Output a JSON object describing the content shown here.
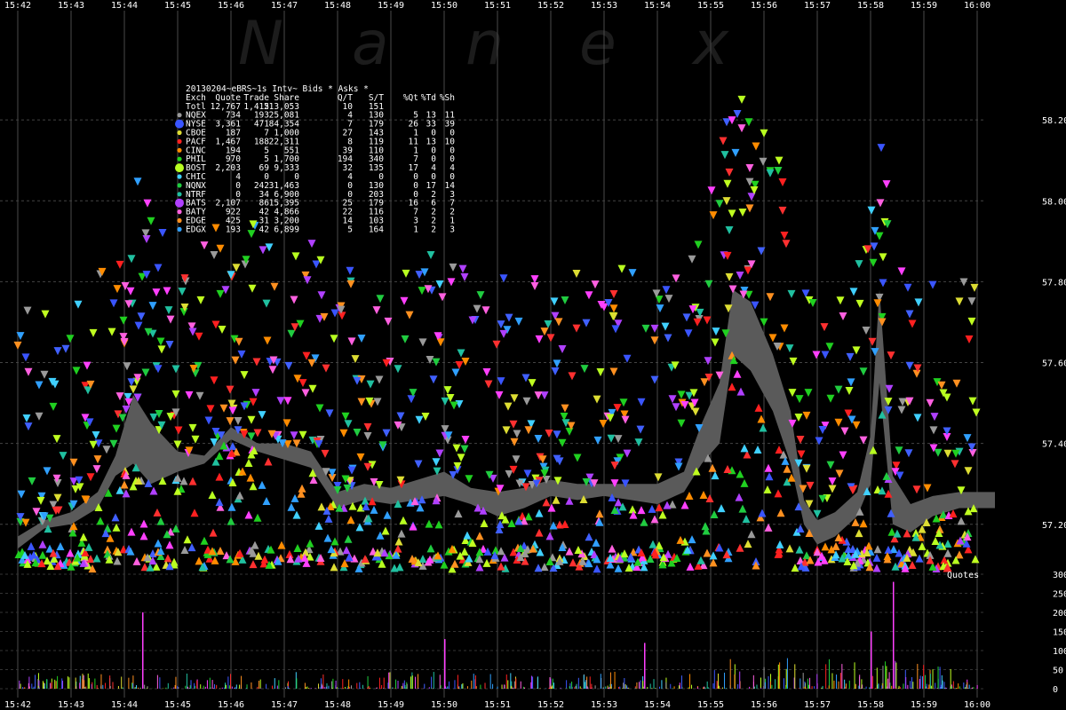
{
  "watermark_letters": [
    "N",
    "a",
    "n",
    "e",
    "x"
  ],
  "chart_data": [
    {
      "type": "scatter",
      "title": "",
      "x_ticks": [
        "15:42",
        "15:43",
        "15:44",
        "15:45",
        "15:46",
        "15:47",
        "15:48",
        "15:49",
        "15:50",
        "15:51",
        "15:52",
        "15:53",
        "15:54",
        "15:55",
        "15:56",
        "15:57",
        "15:58",
        "15:59",
        "16:00"
      ],
      "y_ticks": [
        "58.20",
        "58.00",
        "57.80",
        "57.60",
        "57.40",
        "57.20"
      ],
      "ylim": [
        57.07,
        58.3
      ],
      "grid": true,
      "description_series": [
        {
          "name": "Bids",
          "marker": "triangle-up"
        },
        {
          "name": "Asks",
          "marker": "triangle-down"
        }
      ],
      "nbbo_spread_band": [
        {
          "x": "15:42:00",
          "y": [
            57.14,
            57.17
          ]
        },
        {
          "x": "15:42:30",
          "y": [
            57.19,
            57.21
          ]
        },
        {
          "x": "15:43:00",
          "y": [
            57.2,
            57.23
          ]
        },
        {
          "x": "15:43:30",
          "y": [
            57.24,
            57.28
          ]
        },
        {
          "x": "15:43:50",
          "y": [
            57.32,
            57.37
          ]
        },
        {
          "x": "15:44:10",
          "y": [
            57.35,
            57.52
          ]
        },
        {
          "x": "15:44:30",
          "y": [
            57.3,
            57.45
          ]
        },
        {
          "x": "15:45:00",
          "y": [
            57.33,
            57.38
          ]
        },
        {
          "x": "15:45:30",
          "y": [
            57.35,
            57.37
          ]
        },
        {
          "x": "15:46:00",
          "y": [
            57.41,
            57.44
          ]
        },
        {
          "x": "15:46:30",
          "y": [
            57.38,
            57.4
          ]
        },
        {
          "x": "15:47:00",
          "y": [
            57.36,
            57.4
          ]
        },
        {
          "x": "15:47:30",
          "y": [
            57.34,
            57.38
          ]
        },
        {
          "x": "15:48:00",
          "y": [
            57.24,
            57.28
          ]
        },
        {
          "x": "15:48:30",
          "y": [
            57.26,
            57.3
          ]
        },
        {
          "x": "15:49:00",
          "y": [
            57.25,
            57.29
          ]
        },
        {
          "x": "15:49:30",
          "y": [
            57.26,
            57.31
          ]
        },
        {
          "x": "15:50:00",
          "y": [
            57.27,
            57.33
          ]
        },
        {
          "x": "15:50:30",
          "y": [
            57.25,
            57.29
          ]
        },
        {
          "x": "15:51:00",
          "y": [
            57.22,
            57.28
          ]
        },
        {
          "x": "15:51:30",
          "y": [
            57.24,
            57.29
          ]
        },
        {
          "x": "15:52:00",
          "y": [
            57.27,
            57.31
          ]
        },
        {
          "x": "15:52:30",
          "y": [
            57.26,
            57.3
          ]
        },
        {
          "x": "15:53:00",
          "y": [
            57.27,
            57.3
          ]
        },
        {
          "x": "15:53:30",
          "y": [
            57.26,
            57.3
          ]
        },
        {
          "x": "15:54:00",
          "y": [
            57.25,
            57.3
          ]
        },
        {
          "x": "15:54:30",
          "y": [
            57.28,
            57.33
          ]
        },
        {
          "x": "15:54:50",
          "y": [
            57.35,
            57.45
          ]
        },
        {
          "x": "15:55:10",
          "y": [
            57.4,
            57.55
          ]
        },
        {
          "x": "15:55:25",
          "y": [
            57.62,
            57.78
          ]
        },
        {
          "x": "15:55:45",
          "y": [
            57.58,
            57.75
          ]
        },
        {
          "x": "15:56:10",
          "y": [
            57.48,
            57.62
          ]
        },
        {
          "x": "15:56:30",
          "y": [
            57.35,
            57.48
          ]
        },
        {
          "x": "15:56:45",
          "y": [
            57.2,
            57.26
          ]
        },
        {
          "x": "15:57:00",
          "y": [
            57.15,
            57.21
          ]
        },
        {
          "x": "15:57:20",
          "y": [
            57.17,
            57.23
          ]
        },
        {
          "x": "15:57:45",
          "y": [
            57.22,
            57.28
          ]
        },
        {
          "x": "15:58:00",
          "y": [
            57.3,
            57.42
          ]
        },
        {
          "x": "15:58:10",
          "y": [
            57.55,
            57.78
          ]
        },
        {
          "x": "15:58:25",
          "y": [
            57.2,
            57.32
          ]
        },
        {
          "x": "15:58:45",
          "y": [
            57.18,
            57.25
          ]
        },
        {
          "x": "15:59:10",
          "y": [
            57.22,
            57.27
          ]
        },
        {
          "x": "15:59:40",
          "y": [
            57.24,
            57.28
          ]
        },
        {
          "x": "16:00:20",
          "y": [
            57.24,
            57.28
          ]
        }
      ]
    },
    {
      "type": "bar",
      "title": "Quotes",
      "y_ticks": [
        300,
        250,
        200,
        150,
        100,
        50,
        0
      ],
      "ylim": [
        0,
        300
      ],
      "x_ticks": [
        "15:42",
        "15:43",
        "15:44",
        "15:45",
        "15:46",
        "15:47",
        "15:48",
        "15:49",
        "15:50",
        "15:51",
        "15:52",
        "15:53",
        "15:54",
        "15:55",
        "15:56",
        "15:57",
        "15:58",
        "15:59",
        "16:00"
      ],
      "peaks": [
        {
          "x": "15:44:20",
          "value": 200
        },
        {
          "x": "15:50:00",
          "value": 130
        },
        {
          "x": "15:53:45",
          "value": 120
        },
        {
          "x": "15:58:25",
          "value": 280
        },
        {
          "x": "15:58:00",
          "value": 150
        }
      ]
    }
  ],
  "stats": {
    "title": "20130204~eBRS~1s Intv~ Bids * Asks *",
    "columns": [
      "Exch",
      "Quote",
      "Trade",
      "Share",
      "Q/T",
      "S/T",
      "%Qt",
      "%Td",
      "%Sh"
    ],
    "total": [
      "Totl",
      "12,767",
      "1,415",
      "213,053",
      "10",
      "151",
      "",
      "",
      ""
    ],
    "rows": [
      {
        "color": "#9a9a9a",
        "cells": [
          "NQEX",
          "734",
          "193",
          "25,081",
          "4",
          "130",
          "5",
          "13",
          "11"
        ]
      },
      {
        "color": "#3a55ff",
        "cells": [
          "NYSE",
          "3,361",
          "471",
          "84,354",
          "7",
          "179",
          "26",
          "33",
          "39"
        ]
      },
      {
        "color": "#dddd33",
        "cells": [
          "CBOE",
          "187",
          "7",
          "1,000",
          "27",
          "143",
          "1",
          "0",
          "0"
        ]
      },
      {
        "color": "#ff2020",
        "cells": [
          "PACF",
          "1,467",
          "188",
          "22,311",
          "8",
          "119",
          "11",
          "13",
          "10"
        ]
      },
      {
        "color": "#ff8c00",
        "cells": [
          "CINC",
          "194",
          "5",
          "551",
          "39",
          "110",
          "1",
          "0",
          "0"
        ]
      },
      {
        "color": "#20d020",
        "cells": [
          "PHIL",
          "970",
          "5",
          "1,700",
          "194",
          "340",
          "7",
          "0",
          "0"
        ]
      },
      {
        "color": "#b8ff20",
        "cells": [
          "BOST",
          "2,203",
          "69",
          "9,333",
          "32",
          "135",
          "17",
          "4",
          "4"
        ]
      },
      {
        "color": "#40d0ff",
        "cells": [
          "CHIC",
          "4",
          "0",
          "0",
          "4",
          "0",
          "0",
          "0",
          "0"
        ]
      },
      {
        "color": "#20cc40",
        "cells": [
          "NQNX",
          "0",
          "242",
          "31,463",
          "0",
          "130",
          "0",
          "17",
          "14"
        ]
      },
      {
        "color": "#20c0a0",
        "cells": [
          "NTRF",
          "0",
          "34",
          "6,900",
          "0",
          "203",
          "0",
          "2",
          "3"
        ]
      },
      {
        "color": "#b040ff",
        "cells": [
          "BATS",
          "2,107",
          "86",
          "15,395",
          "25",
          "179",
          "16",
          "6",
          "7"
        ]
      },
      {
        "color": "#ff60e0",
        "cells": [
          "BATY",
          "922",
          "42",
          "4,866",
          "22",
          "116",
          "7",
          "2",
          "2"
        ]
      },
      {
        "color": "#ff9020",
        "cells": [
          "EDGE",
          "425",
          "31",
          "3,200",
          "14",
          "103",
          "3",
          "2",
          "1"
        ]
      },
      {
        "color": "#30a0ff",
        "cells": [
          "EDGX",
          "193",
          "42",
          "6,899",
          "5",
          "164",
          "1",
          "2",
          "3"
        ]
      }
    ]
  }
}
